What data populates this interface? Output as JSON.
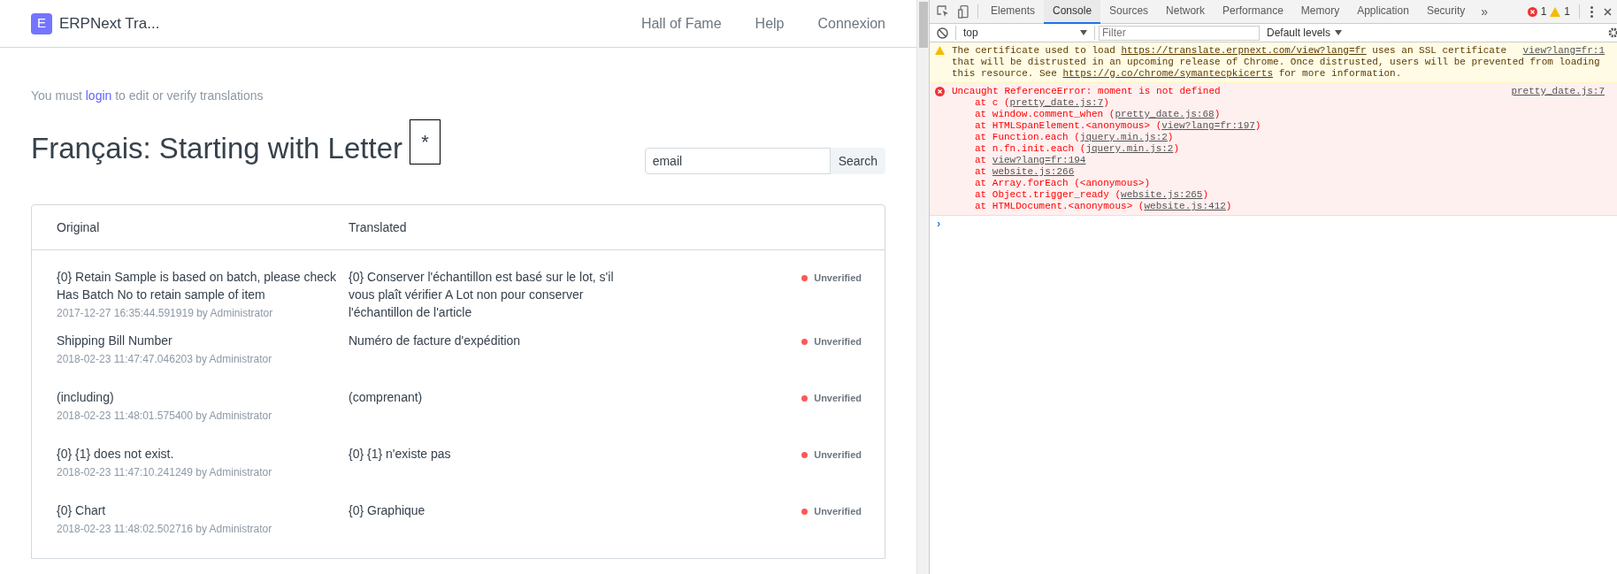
{
  "site": {
    "logo_letter": "E",
    "brand": "ERPNext Tra...",
    "nav": [
      "Hall of Fame",
      "Help",
      "Connexion"
    ]
  },
  "notice": {
    "before": "You must ",
    "link": "login",
    "after": " to edit or verify translations"
  },
  "heading": {
    "title": "Français: Starting with Letter",
    "letter": "*"
  },
  "search": {
    "value": "email",
    "button": "Search"
  },
  "table": {
    "columns": [
      "Original",
      "Translated"
    ],
    "rows": [
      {
        "original": "{0} Retain Sample is based on batch, please check Has Batch No to retain sample of item",
        "meta": "2017-12-27 16:35:44.591919 by Administrator",
        "translated": "{0} Conserver l'échantillon est basé sur le lot, s'il vous plaît vérifier A Lot non pour conserver l'échantillon de l'article",
        "status": "Unverified",
        "verified": false
      },
      {
        "original": "Shipping Bill Number",
        "meta": "2018-02-23 11:47:47.046203 by Administrator",
        "translated": "Numéro de facture d'expédition",
        "status": "Unverified",
        "verified": false
      },
      {
        "original": "(including)",
        "meta": "2018-02-23 11:48:01.575400 by Administrator",
        "translated": "(comprenant)",
        "status": "Unverified",
        "verified": false
      },
      {
        "original": "{0} {1} does not exist.",
        "meta": "2018-02-23 11:47:10.241249 by Administrator",
        "translated": "{0} {1} n'existe pas",
        "status": "Unverified",
        "verified": false
      },
      {
        "original": "{0} Chart",
        "meta": "2018-02-23 11:48:02.502716 by Administrator",
        "translated": "{0} Graphique",
        "status": "Unverified",
        "verified": false
      }
    ]
  },
  "devtools": {
    "tabs": [
      {
        "label": "Elements",
        "selected": false
      },
      {
        "label": "Console",
        "selected": true
      },
      {
        "label": "Sources",
        "selected": false
      },
      {
        "label": "Network",
        "selected": false
      },
      {
        "label": "Performance",
        "selected": false
      },
      {
        "label": "Memory",
        "selected": false
      },
      {
        "label": "Application",
        "selected": false
      },
      {
        "label": "Security",
        "selected": false
      }
    ],
    "more": "»",
    "error_count": "1",
    "warning_count": "1",
    "context": "top",
    "filter_placeholder": "Filter",
    "levels": "Default levels",
    "messages": [
      {
        "kind": "warning",
        "source": "view?lang=fr:1",
        "lines": [
          [
            {
              "text": "The certificate used to load "
            },
            {
              "text": "https://translate.erpnext.com/view?lang=fr",
              "link": true
            },
            {
              "text": " uses an SSL certificate"
            }
          ],
          [
            {
              "text": "that will be distrusted in an upcoming release of Chrome. Once distrusted, users will be prevented from loading"
            }
          ],
          [
            {
              "text": "this resource. See "
            },
            {
              "text": "https://g.co/chrome/symantecpkicerts",
              "link": true
            },
            {
              "text": " for more information."
            }
          ]
        ]
      },
      {
        "kind": "error",
        "source": "pretty_date.js:7",
        "lines": [
          [
            {
              "text": "Uncaught ReferenceError: moment is not defined"
            }
          ]
        ],
        "stack": [
          [
            {
              "text": "at c ("
            },
            {
              "text": "pretty_date.js:7",
              "link": true
            },
            {
              "text": ")"
            }
          ],
          [
            {
              "text": "at window.comment_when ("
            },
            {
              "text": "pretty_date.js:68",
              "link": true
            },
            {
              "text": ")"
            }
          ],
          [
            {
              "text": "at HTMLSpanElement.<anonymous> ("
            },
            {
              "text": "view?lang=fr:197",
              "link": true
            },
            {
              "text": ")"
            }
          ],
          [
            {
              "text": "at Function.each ("
            },
            {
              "text": "jquery.min.js:2",
              "link": true
            },
            {
              "text": ")"
            }
          ],
          [
            {
              "text": "at n.fn.init.each ("
            },
            {
              "text": "jquery.min.js:2",
              "link": true
            },
            {
              "text": ")"
            }
          ],
          [
            {
              "text": "at "
            },
            {
              "text": "view?lang=fr:194",
              "link": true
            }
          ],
          [
            {
              "text": "at "
            },
            {
              "text": "website.js:266",
              "link": true
            }
          ],
          [
            {
              "text": "at Array.forEach (<anonymous>)"
            }
          ],
          [
            {
              "text": "at Object.trigger_ready ("
            },
            {
              "text": "website.js:265",
              "link": true
            },
            {
              "text": ")"
            }
          ],
          [
            {
              "text": "at HTMLDocument.<anonymous> ("
            },
            {
              "text": "website.js:412",
              "link": true
            },
            {
              "text": ")"
            }
          ]
        ]
      }
    ],
    "prompt": "›"
  }
}
